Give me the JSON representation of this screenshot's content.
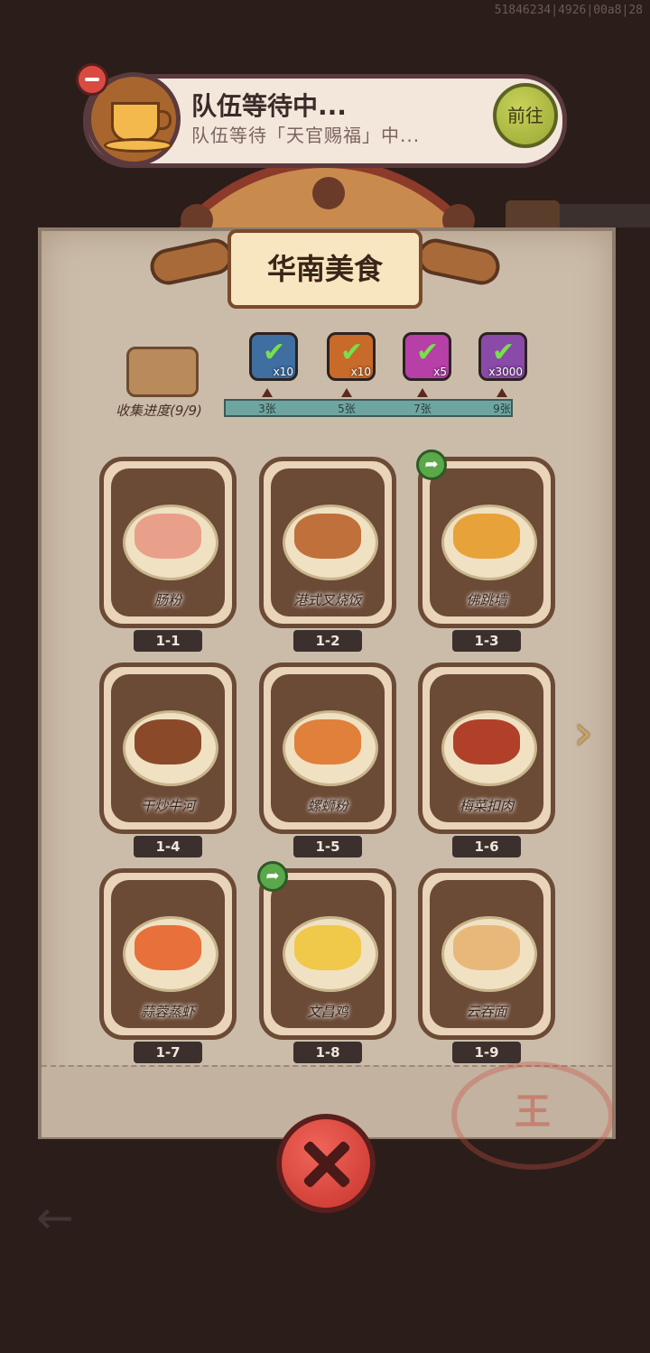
{
  "debug_id": "51846234|4926|00a8|28",
  "team": {
    "title": "队伍等待中...",
    "subtitle": "队伍等待「天官赐福」中...",
    "go_label": "前往"
  },
  "panel": {
    "title": "华南美食",
    "collect_label": "收集进度(9/9)"
  },
  "rewards": [
    {
      "icon": "treasure-chest-icon",
      "qty": "x10",
      "claimed": true,
      "color": "#3f6ea0"
    },
    {
      "icon": "key-icon",
      "qty": "x10",
      "claimed": true,
      "color": "#c86a2a"
    },
    {
      "icon": "gem-icon",
      "qty": "x5",
      "claimed": true,
      "color": "#b63fa8"
    },
    {
      "icon": "crystal-icon",
      "qty": "x3000",
      "claimed": true,
      "color": "#8a4aa8"
    }
  ],
  "progress": {
    "value": 1.0,
    "ticks": [
      "3张",
      "5张",
      "7张",
      "9张"
    ]
  },
  "cards": [
    {
      "num": "1-1",
      "name": "肠粉",
      "shared": false,
      "food_color": "#e8a08a"
    },
    {
      "num": "1-2",
      "name": "港式叉烧饭",
      "shared": false,
      "food_color": "#c0703a"
    },
    {
      "num": "1-3",
      "name": "佛跳墙",
      "shared": true,
      "food_color": "#e8a23a"
    },
    {
      "num": "1-4",
      "name": "干炒牛河",
      "shared": false,
      "food_color": "#8a4a2a"
    },
    {
      "num": "1-5",
      "name": "螺蛳粉",
      "shared": false,
      "food_color": "#e0803a"
    },
    {
      "num": "1-6",
      "name": "梅菜扣肉",
      "shared": false,
      "food_color": "#b0402a"
    },
    {
      "num": "1-7",
      "name": "蒜蓉蒸虾",
      "shared": false,
      "food_color": "#e8703a"
    },
    {
      "num": "1-8",
      "name": "文昌鸡",
      "shared": true,
      "food_color": "#f0c84a"
    },
    {
      "num": "1-9",
      "name": "云吞面",
      "shared": false,
      "food_color": "#e8b87a"
    }
  ]
}
